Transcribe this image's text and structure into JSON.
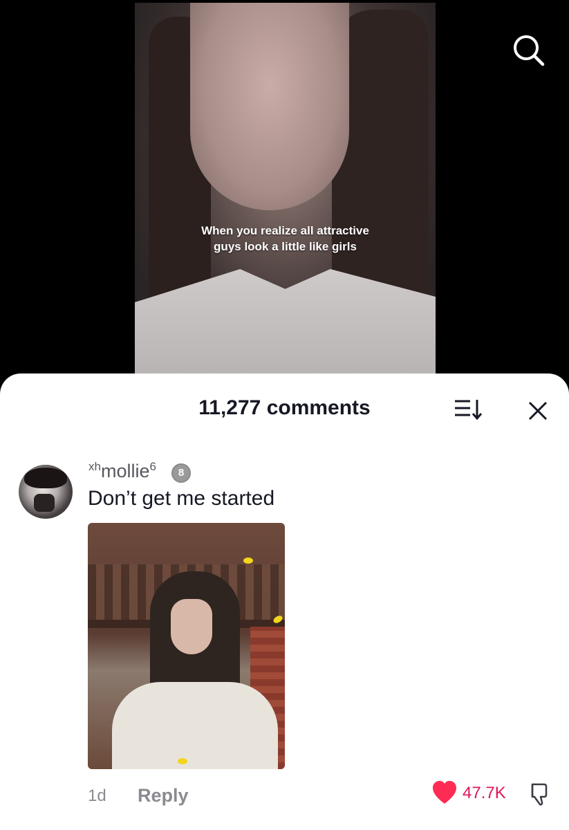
{
  "video": {
    "caption_lines": [
      "When you realize all attractive",
      "guys look a little like girls"
    ]
  },
  "header": {
    "search_icon": "search-icon"
  },
  "comments_sheet": {
    "title": "11,277 comments",
    "sort_icon": "sort-icon",
    "close_icon": "close-icon"
  },
  "comment": {
    "username": "mollie",
    "username_prefix": "xh",
    "username_suffix": "6",
    "badge": "8",
    "text": "Don’t get me started",
    "time": "1d",
    "reply_label": "Reply",
    "like_count": "47.7K",
    "liked": true,
    "like_color": "#fe2c55"
  }
}
